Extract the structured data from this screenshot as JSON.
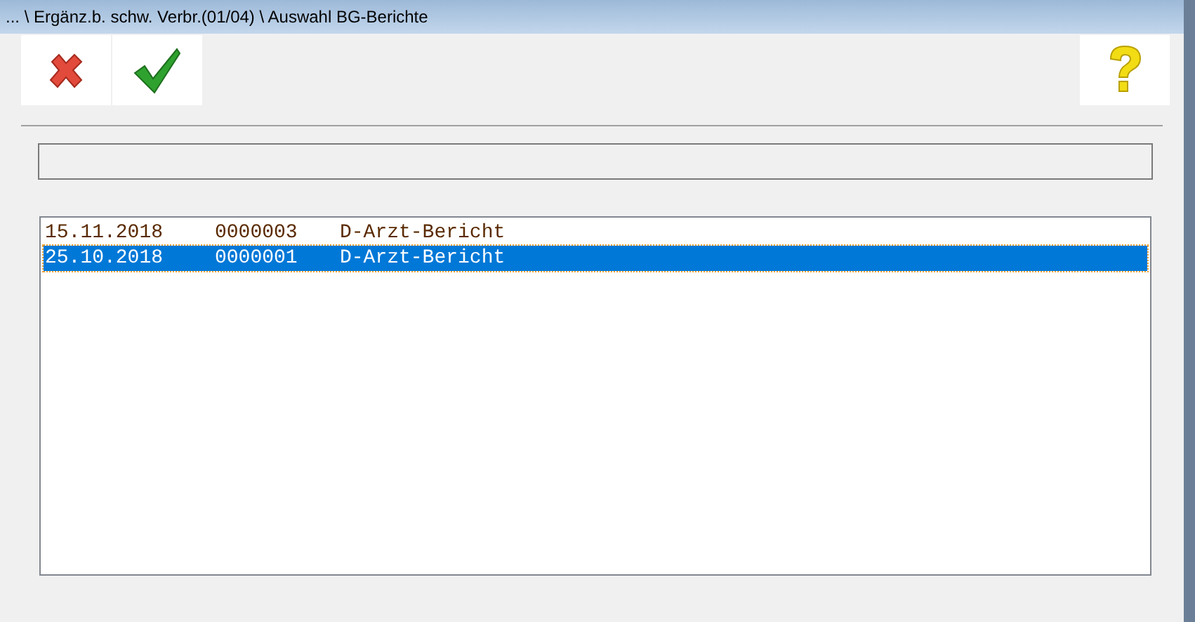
{
  "window": {
    "title": "... \\ Ergänz.b. schw. Verbr.(01/04) \\ Auswahl BG-Berichte"
  },
  "toolbar": {
    "buttons": [
      {
        "kind": "cancel"
      },
      {
        "kind": "confirm"
      }
    ],
    "help_button": {
      "kind": "help"
    }
  },
  "list": {
    "rows": [
      {
        "date": "15.11.2018",
        "number": "0000003",
        "type": "D-Arzt-Bericht",
        "selected": false
      },
      {
        "date": "25.10.2018",
        "number": "0000001",
        "type": "D-Arzt-Bericht",
        "selected": true
      }
    ]
  }
}
